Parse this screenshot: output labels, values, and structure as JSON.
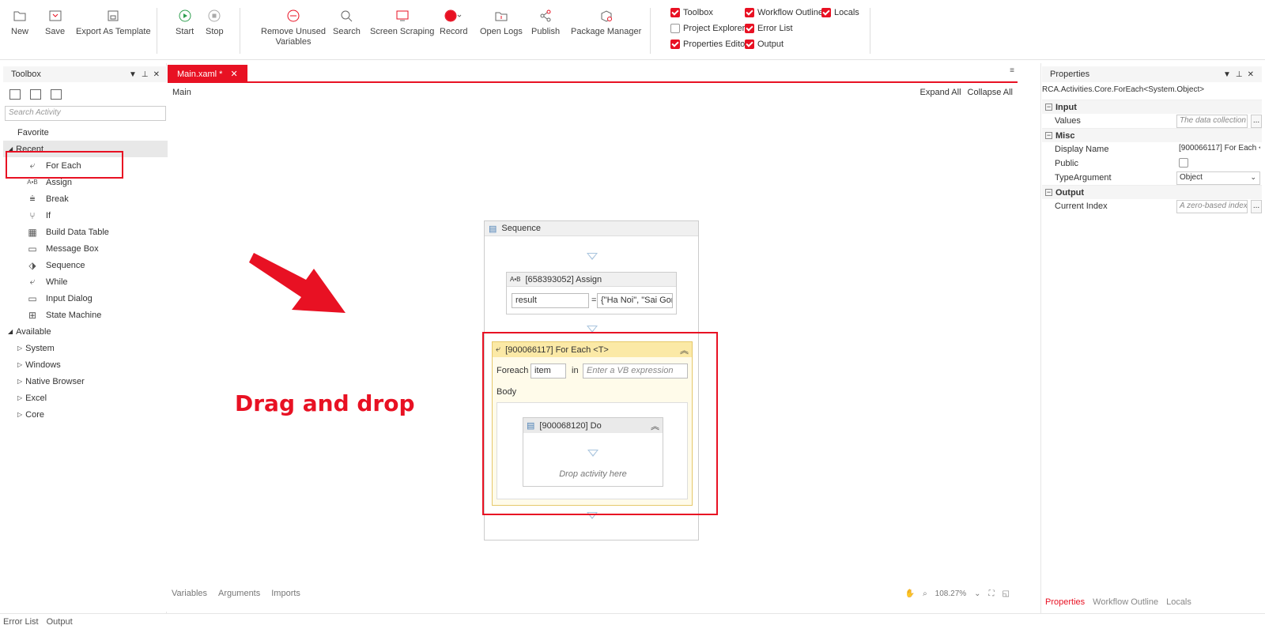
{
  "ribbon": {
    "buttons": [
      {
        "label": "New",
        "icon": "folder-plus-icon"
      },
      {
        "label": "Save",
        "icon": "save-icon"
      },
      {
        "label": "Export As Template",
        "icon": "export-icon"
      },
      {
        "label": "Start",
        "icon": "play-icon"
      },
      {
        "label": "Stop",
        "icon": "stop-icon"
      },
      {
        "label": "Remove Unused\nVariables",
        "icon": "minus-circle-icon"
      },
      {
        "label": "Search",
        "icon": "search-icon"
      },
      {
        "label": "Screen Scraping",
        "icon": "screen-icon"
      },
      {
        "label": "Record",
        "icon": "record-icon"
      },
      {
        "label": "Open Logs",
        "icon": "folder-open-icon"
      },
      {
        "label": "Publish",
        "icon": "share-icon"
      },
      {
        "label": "Package Manager",
        "icon": "package-icon"
      }
    ],
    "checks": [
      {
        "label": "Toolbox",
        "checked": true
      },
      {
        "label": "Workflow Outline",
        "checked": true
      },
      {
        "label": "Locals",
        "checked": true
      },
      {
        "label": "Project Explorer",
        "checked": false
      },
      {
        "label": "Error List",
        "checked": true
      },
      {
        "label": "Properties Editor",
        "checked": true
      },
      {
        "label": "Output",
        "checked": true
      }
    ]
  },
  "toolbox": {
    "title": "Toolbox",
    "search_placeholder": "Search Activity",
    "favorite": "Favorite",
    "recent": "Recent",
    "recent_items": [
      "For Each",
      "Assign",
      "Break",
      "If",
      "Build Data Table",
      "Message Box",
      "Sequence",
      "While",
      "Input Dialog",
      "State Machine"
    ],
    "available": "Available",
    "available_items": [
      "System",
      "Windows",
      "Native Browser",
      "Excel",
      "Core"
    ]
  },
  "designer": {
    "tab_label": "Main.xaml *",
    "breadcrumb": "Main",
    "expand_all": "Expand All",
    "collapse_all": "Collapse All",
    "sequence_title": "Sequence",
    "assign_title": "[658393052] Assign",
    "assign_left": "result",
    "assign_eq": "=",
    "assign_right": "{\"Ha Noi\", \"Sai Gon",
    "foreach_title": "[900066117] For Each <T>",
    "foreach_label": "Foreach",
    "foreach_var": "item",
    "foreach_in": "in",
    "foreach_expr_placeholder": "Enter a VB expression",
    "body_label": "Body",
    "do_title": "[900068120] Do",
    "drop_hint": "Drop activity here",
    "annotation": "Drag and drop",
    "bottom_links": [
      "Variables",
      "Arguments",
      "Imports"
    ],
    "zoom": "108.27%"
  },
  "properties": {
    "title": "Properties",
    "type_path": "RCA.Activities.Core.ForEach<System.Object>",
    "groups": [
      {
        "name": "Input",
        "rows": [
          {
            "label": "Values",
            "value": "The data collection",
            "placeholder": true,
            "ellipsis": true
          }
        ]
      },
      {
        "name": "Misc",
        "rows": [
          {
            "label": "Display Name",
            "value": "[900066117] For Each <",
            "placeholder": false,
            "ellipsis": false,
            "plain": true
          },
          {
            "label": "Public",
            "value": "",
            "checkbox": true
          },
          {
            "label": "TypeArgument",
            "value": "Object",
            "dropdown": true
          }
        ]
      },
      {
        "name": "Output",
        "rows": [
          {
            "label": "Current Index",
            "value": "A zero-based index",
            "placeholder": true,
            "ellipsis": true
          }
        ]
      }
    ],
    "tabs": [
      "Properties",
      "Workflow Outline",
      "Locals"
    ]
  },
  "status": [
    "Error List",
    "Output"
  ],
  "colors": {
    "accent": "#e81123",
    "foreach_header": "#fbe9a6"
  }
}
